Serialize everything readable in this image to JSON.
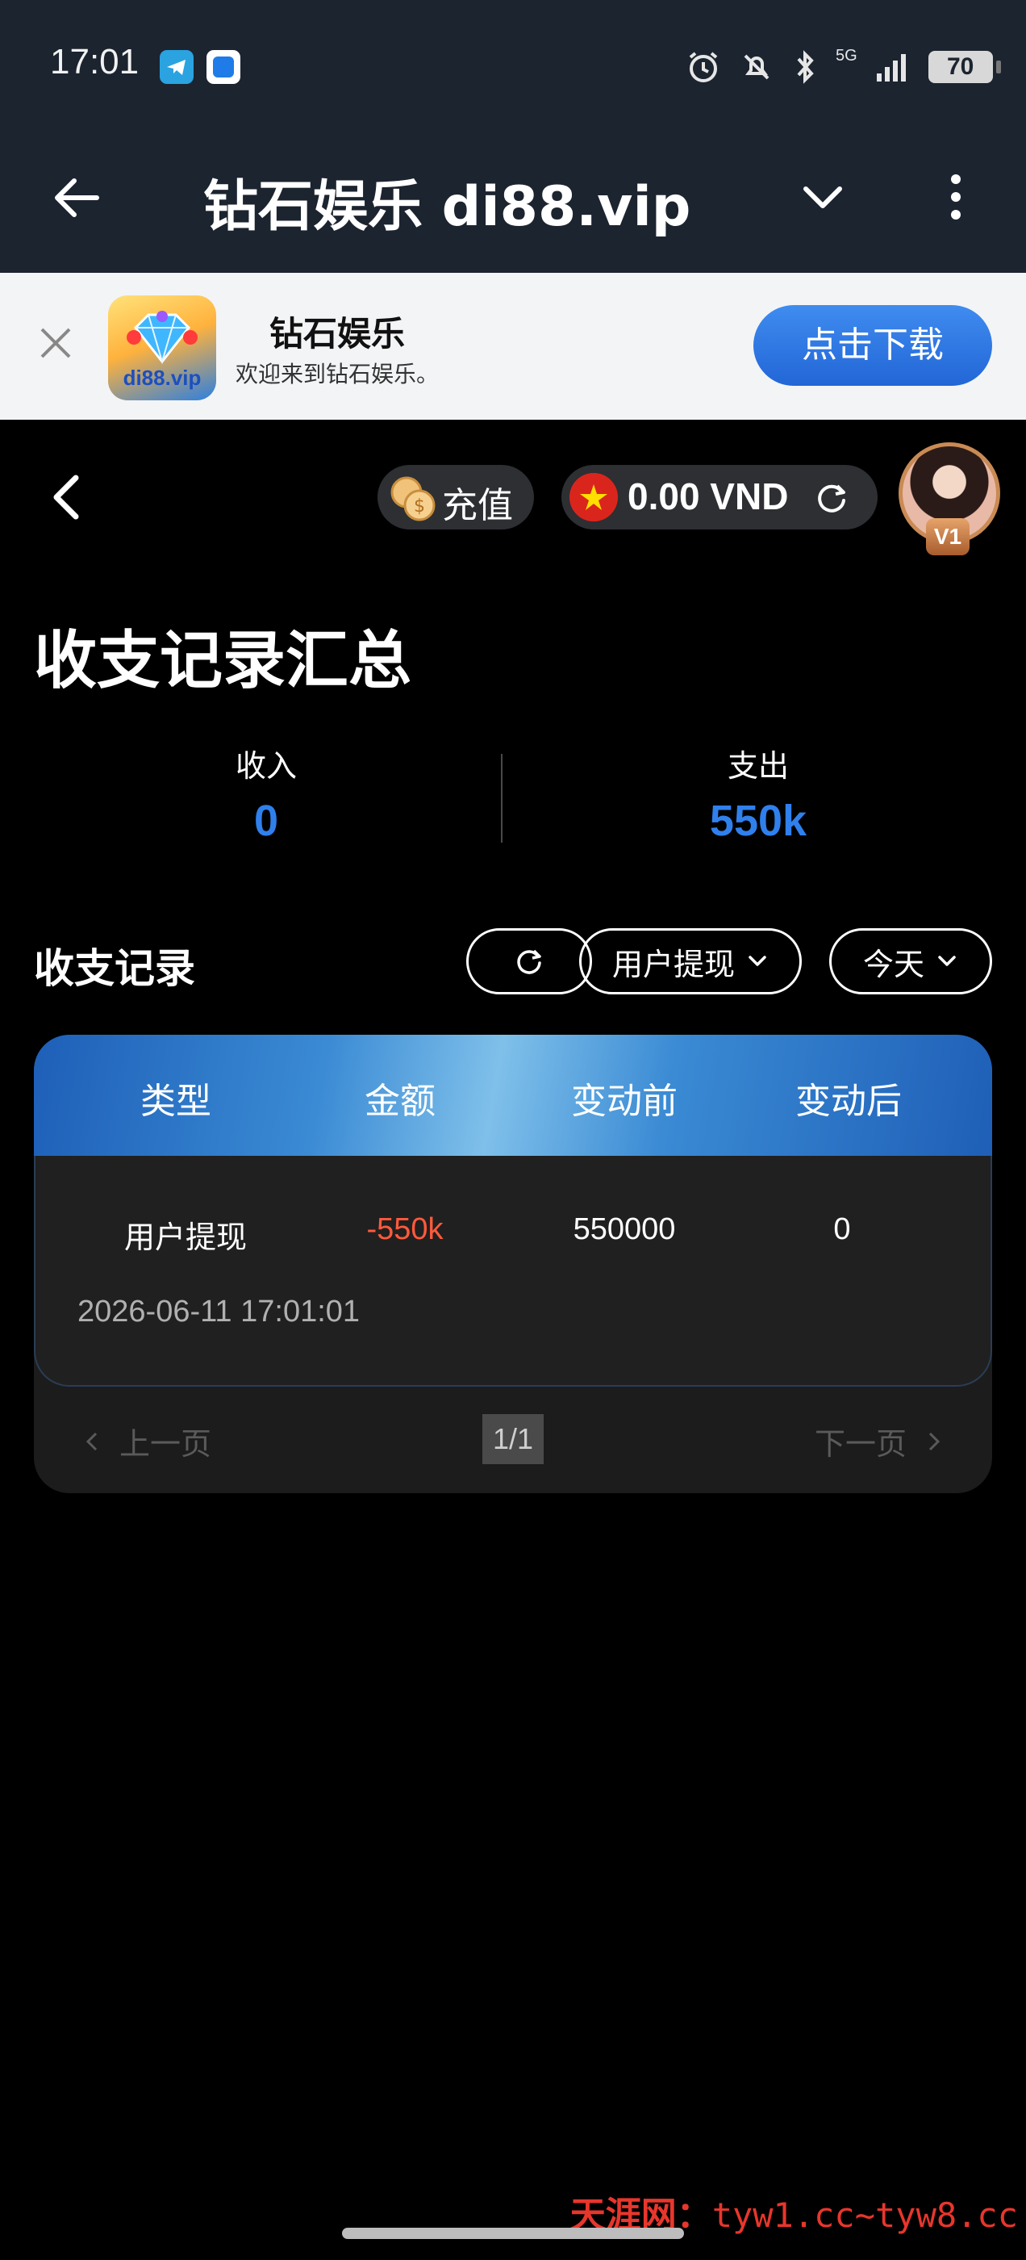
{
  "status_bar": {
    "time": "17:01",
    "network": "5G",
    "battery": "70"
  },
  "top_bar": {
    "title": "钻石娱乐 di88.vip"
  },
  "banner": {
    "logo_text": "di88.vip",
    "app_name": "钻石娱乐",
    "tagline": "欢迎来到钻石娱乐。",
    "download_label": "点击下载"
  },
  "header": {
    "recharge_label": "充值",
    "balance": "0.00 VND",
    "vip_level": "V1"
  },
  "summary": {
    "title": "收支记录汇总",
    "income_label": "收入",
    "income_value": "0",
    "expense_label": "支出",
    "expense_value": "550k"
  },
  "records": {
    "title": "收支记录",
    "type_filter": "用户提现",
    "date_filter": "今天",
    "columns": [
      "类型",
      "金额",
      "变动前",
      "变动后"
    ],
    "rows": [
      {
        "type": "用户提现",
        "amount": "-550k",
        "before": "550000",
        "after": "0",
        "time": "2026-06-11 17:01:01"
      }
    ],
    "pager": {
      "prev": "上一页",
      "page": "1/1",
      "next": "下一页"
    }
  },
  "watermark": {
    "label": "天涯网：",
    "url": "tyw1.cc~tyw8.cc"
  },
  "colors": {
    "accent": "#2f80ed",
    "negative": "#ff5a3c",
    "bar": "#1c2430"
  }
}
